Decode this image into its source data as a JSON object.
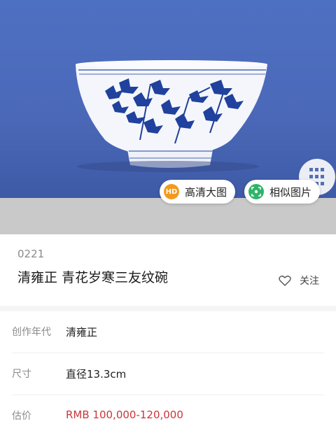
{
  "image_actions": {
    "hd_badge": "HD",
    "hd_label": "高清大图",
    "similar_label": "相似图片"
  },
  "lot": {
    "number": "0221",
    "title": "清雍正 青花岁寒三友纹碗",
    "follow_label": "关注"
  },
  "details": [
    {
      "key": "创作年代",
      "value": "清雍正"
    },
    {
      "key": "尺寸",
      "value": "直径13.3cm"
    },
    {
      "key": "估价",
      "value": "RMB  100,000-120,000"
    }
  ],
  "colors": {
    "price": "#c9373a",
    "hd_icon": "#f29a1f",
    "similar_icon": "#2fb46b"
  }
}
